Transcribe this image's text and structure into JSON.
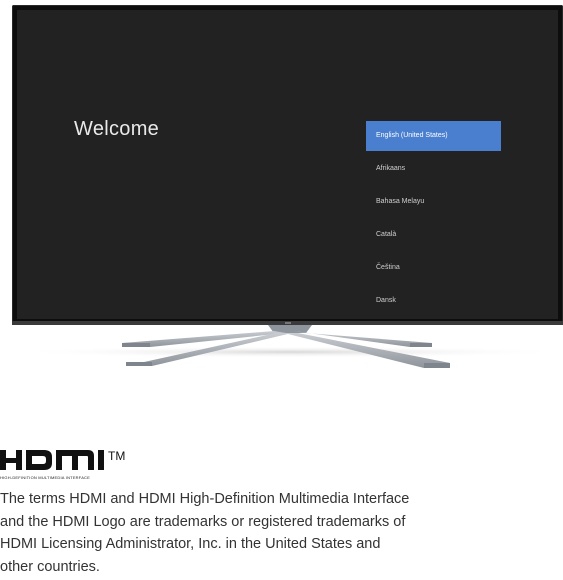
{
  "tv_screen": {
    "welcome_title": "Welcome",
    "languages": [
      {
        "label": "English (United States)",
        "selected": true
      },
      {
        "label": "Afrikaans",
        "selected": false
      },
      {
        "label": "Bahasa Melayu",
        "selected": false
      },
      {
        "label": "Català",
        "selected": false
      },
      {
        "label": "Čeština",
        "selected": false
      },
      {
        "label": "Dansk",
        "selected": false
      }
    ],
    "accent_color": "#4a7fcf"
  },
  "hdmi": {
    "logo_text": "HDMI",
    "trademark_symbol": "™",
    "subtitle": "HIGH-DEFINITION MULTIMEDIA INTERFACE",
    "legal_lines": [
      "The terms HDMI and HDMI High-Definition Multimedia Interface",
      "and the HDMI Logo are trademarks or registered trademarks of",
      "HDMI Licensing Administrator, Inc. in the United States and",
      "other countries."
    ]
  }
}
